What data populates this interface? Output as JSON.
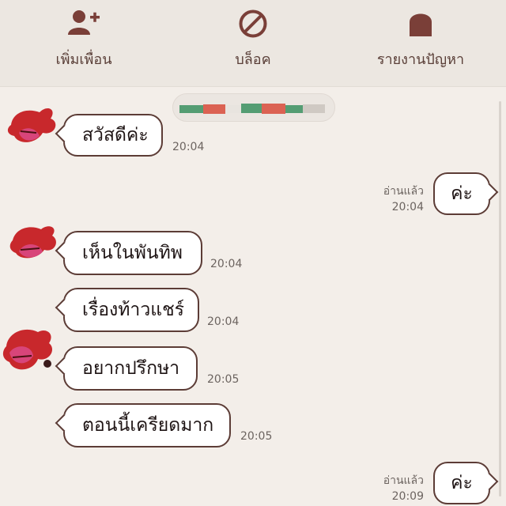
{
  "top_actions": [
    {
      "label": "เพิ่มเพื่อน",
      "icon": "add-friend-icon"
    },
    {
      "label": "บล็อค",
      "icon": "block-icon"
    },
    {
      "label": "รายงานปัญหา",
      "icon": "report-icon"
    }
  ],
  "colors": {
    "accent": "#7a3f38",
    "bubble_border": "#5c3c36",
    "background": "#f3eee9"
  },
  "messages": [
    {
      "sender": "other",
      "text": "สวัสดีค่ะ",
      "time": "20:04"
    },
    {
      "sender": "me",
      "text": "ค่ะ",
      "read": "อ่านแล้ว",
      "time": "20:04"
    },
    {
      "sender": "other",
      "text": "เห็นในพันทิพ",
      "time": "20:04"
    },
    {
      "sender": "other",
      "text": "เรื่องท้าวแชร์",
      "time": "20:04"
    },
    {
      "sender": "other",
      "text": "อยากปรึกษา",
      "time": "20:05"
    },
    {
      "sender": "other",
      "text": "ตอนนี้เครียดมาก",
      "time": "20:05"
    },
    {
      "sender": "me",
      "text": "ค่ะ",
      "read": "อ่านแล้ว",
      "time": "20:09"
    }
  ]
}
